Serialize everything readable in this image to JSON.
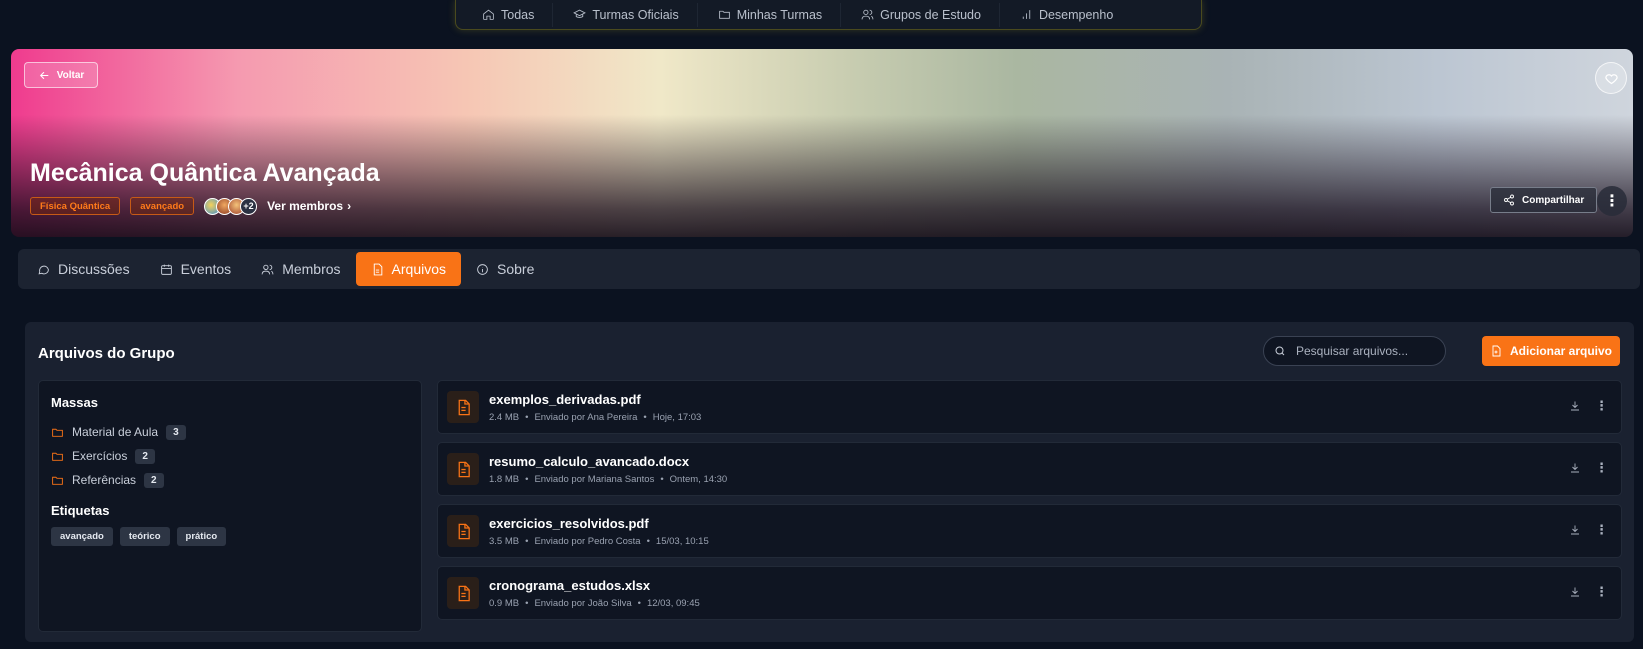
{
  "topnav": {
    "items": [
      {
        "label": "Todas",
        "icon": "home-icon"
      },
      {
        "label": "Turmas Oficiais",
        "icon": "graduation-cap-icon"
      },
      {
        "label": "Minhas Turmas",
        "icon": "folder-icon"
      },
      {
        "label": "Grupos de Estudo",
        "icon": "users-icon"
      },
      {
        "label": "Desempenho",
        "icon": "bar-chart-icon"
      }
    ]
  },
  "hero": {
    "back_label": "Voltar",
    "title": "Mecânica Quântica Avançada",
    "tags": [
      "Física Quântica",
      "avançado"
    ],
    "members_more": "+2",
    "members_link": "Ver membros",
    "share_label": "Compartilhar",
    "gradient_colors": [
      "#ef3b8e",
      "#f6c6b4",
      "#f0e8c8",
      "#aab7a1",
      "#cfd5dd"
    ]
  },
  "tabs": [
    {
      "label": "Discussões",
      "icon": "message-circle-icon",
      "active": false
    },
    {
      "label": "Eventos",
      "icon": "calendar-icon",
      "active": false
    },
    {
      "label": "Membros",
      "icon": "users-icon",
      "active": false
    },
    {
      "label": "Arquivos",
      "icon": "file-icon",
      "active": true
    },
    {
      "label": "Sobre",
      "icon": "info-icon",
      "active": false
    }
  ],
  "files_panel": {
    "title": "Arquivos do Grupo",
    "search_placeholder": "Pesquisar arquivos...",
    "add_label": "Adicionar arquivo",
    "folders_heading": "Massas",
    "folders": [
      {
        "name": "Material de Aula",
        "count": "3"
      },
      {
        "name": "Exercícios",
        "count": "2"
      },
      {
        "name": "Referências",
        "count": "2"
      }
    ],
    "tags_heading": "Etiquetas",
    "tags": [
      "avançado",
      "teórico",
      "prático"
    ],
    "files": [
      {
        "name": "exemplos_derivadas.pdf",
        "size": "2.4 MB",
        "uploader": "Enviado por Ana Pereira",
        "date": "Hoje, 17:03"
      },
      {
        "name": "resumo_calculo_avancado.docx",
        "size": "1.8 MB",
        "uploader": "Enviado por Mariana Santos",
        "date": "Ontem, 14:30"
      },
      {
        "name": "exercicios_resolvidos.pdf",
        "size": "3.5 MB",
        "uploader": "Enviado por Pedro Costa",
        "date": "15/03, 10:15"
      },
      {
        "name": "cronograma_estudos.xlsx",
        "size": "0.9 MB",
        "uploader": "Enviado por João Silva",
        "date": "12/03, 09:45"
      }
    ]
  },
  "colors": {
    "accent": "#f97316",
    "background": "#0b1220",
    "panel": "#1a2130"
  }
}
